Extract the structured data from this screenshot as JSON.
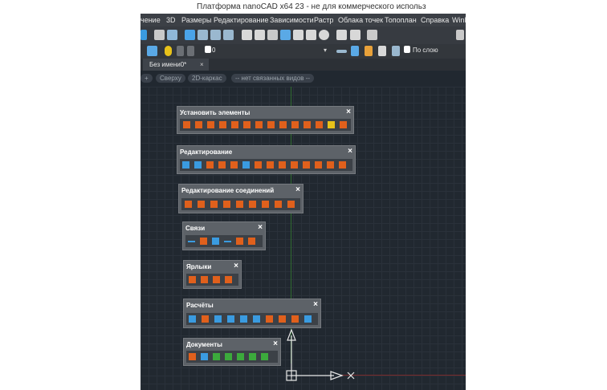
{
  "window": {
    "title": "Платформа nanoCAD x64 23 - не для коммерческого использ"
  },
  "menu": {
    "items": [
      "чение",
      "3D",
      "Размеры",
      "Редактирование",
      "Зависимости",
      "Растр",
      "Облака точек",
      "Топоплан",
      "Справка",
      "WinB"
    ]
  },
  "toolbar": {
    "layer_value": "0",
    "linetype_value": "По слою"
  },
  "tabs": {
    "active_tab": "Без имени0*",
    "close_glyph": "×"
  },
  "view_controls": {
    "plus": "+",
    "view": "Сверху",
    "style": "2D-каркас",
    "linked_views": "-- нет связанных видов --"
  },
  "panels": [
    {
      "title": "Установить элементы",
      "close": "×"
    },
    {
      "title": "Редактирование",
      "close": "×"
    },
    {
      "title": "Редактирование соединений",
      "close": "×"
    },
    {
      "title": "Связи",
      "close": "×"
    },
    {
      "title": "Ярлыки",
      "close": "×"
    },
    {
      "title": "Расчёты",
      "close": "×"
    },
    {
      "title": "Документы",
      "close": "×"
    }
  ],
  "colors": {
    "canvas_bg": "#212830",
    "panel_bg": "#5d6268",
    "accent_orange": "#e0601c",
    "accent_blue": "#3a9be0"
  }
}
